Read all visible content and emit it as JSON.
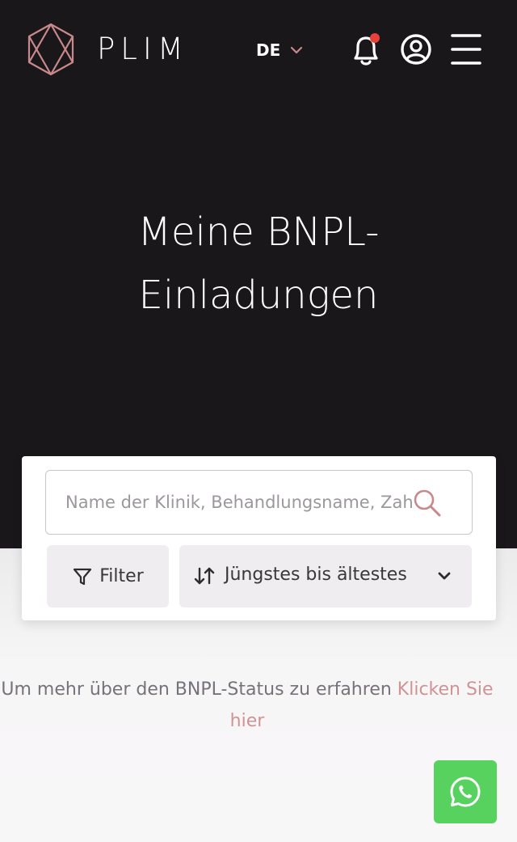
{
  "header": {
    "brand": "PLIM",
    "language": "DE",
    "icons": [
      "hexagon-logo-icon",
      "bell-icon",
      "user-circle-icon",
      "hamburger-menu-icon"
    ],
    "notification_dot_color": "#e8413b"
  },
  "hero": {
    "title_line1": "Meine BNPL-",
    "title_line2": "Einladungen"
  },
  "search": {
    "placeholder": "Name der Klinik, Behandlungsname, Zahlungs-ID"
  },
  "filter": {
    "label": "Filter"
  },
  "sort": {
    "selected": "Jüngstes bis ältestes"
  },
  "info": {
    "text": "Um mehr über den BNPL-Status zu erfahren",
    "link": "Klicken Sie hier"
  },
  "colors": {
    "hero_background": "#1a171b",
    "accent": "#d09394",
    "whatsapp": "#57d25e"
  }
}
